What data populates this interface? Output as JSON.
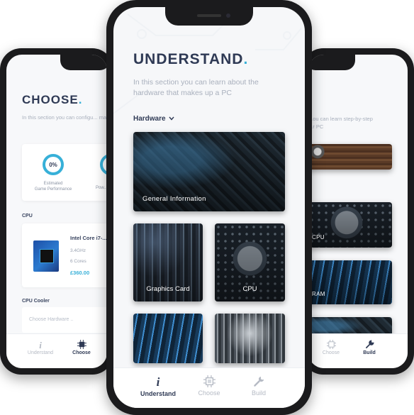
{
  "left_screen": {
    "title": "CHOOSE",
    "title_dot": ".",
    "subtitle": "In this section you can configu... match your budget and perfor...",
    "gauge": {
      "value": "0%",
      "label": "Estimated\nGame Performance",
      "second_label": "Pow..."
    },
    "cpu_section": "CPU",
    "cpu_item": {
      "name": "Intel Core i7-...",
      "ghz": "3.4GHz",
      "cores": "6 Cores",
      "price": "£360.00"
    },
    "cooler_section": "CPU Cooler",
    "cooler_placeholder": "Choose Hardware ..",
    "tabs": [
      {
        "label": "Understand",
        "icon": "info-icon"
      },
      {
        "label": "Choose",
        "icon": "chip-icon"
      }
    ]
  },
  "mid_screen": {
    "title": "UNDERSTAND",
    "title_dot": ".",
    "subtitle_line1": "In this section you can learn about the",
    "subtitle_line2": "hardware that makes up a PC",
    "dropdown": "Hardware",
    "tiles": {
      "general": "General Information",
      "graphics": "Graphics Card",
      "cpu": "CPU"
    },
    "tabs": [
      {
        "label": "Understand",
        "icon": "info-icon"
      },
      {
        "label": "Choose",
        "icon": "chip-icon"
      },
      {
        "label": "Build",
        "icon": "wrench-icon"
      }
    ]
  },
  "right_screen": {
    "subtitle_line1": "...ou can learn step-by-step",
    "subtitle_line2": "...r PC",
    "tiles": {
      "cpu": "CPU",
      "ram": "RAM"
    },
    "tabs": [
      {
        "label": "Choose",
        "icon": "chip-icon"
      },
      {
        "label": "Build",
        "icon": "wrench-icon"
      }
    ]
  },
  "colors": {
    "accent": "#37b0d8",
    "title": "#2f3a55",
    "tab_active": "#2f3a55",
    "tab_inactive": "#b5bac4"
  }
}
